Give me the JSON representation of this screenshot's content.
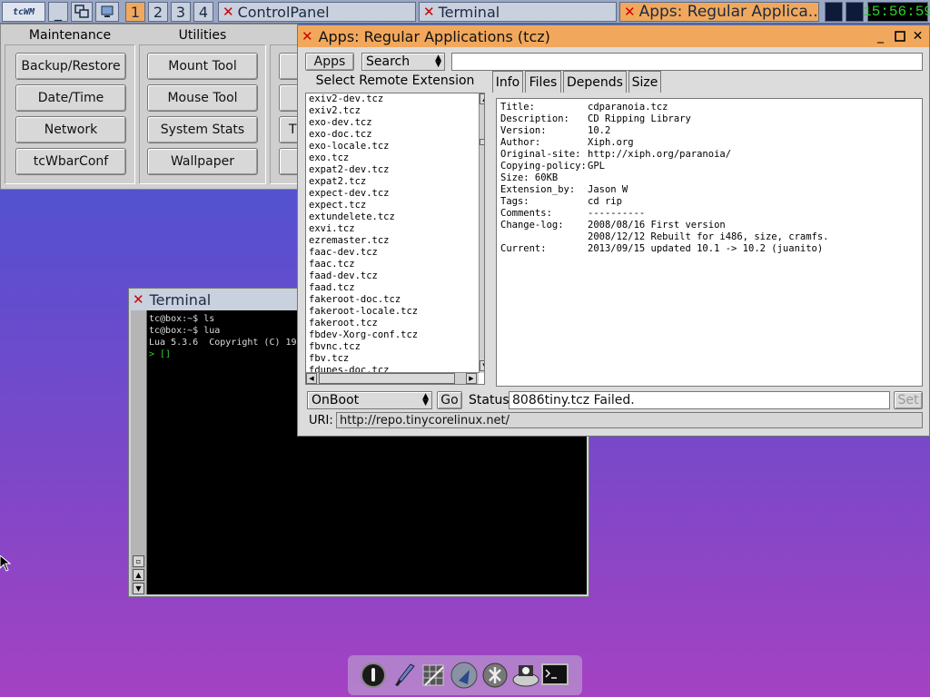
{
  "taskbar": {
    "logo": "tcWM",
    "workspaces": [
      "1",
      "2",
      "3",
      "4"
    ],
    "active_workspace": "1",
    "tasks": [
      {
        "label": "ControlPanel",
        "active": false
      },
      {
        "label": "Terminal",
        "active": false
      },
      {
        "label": "Apps: Regular Applica...",
        "active": true
      }
    ],
    "clock": "15:56:59"
  },
  "controlpanel": {
    "groups": [
      {
        "header": "Maintenance",
        "buttons": [
          "Backup/Restore",
          "Date/Time",
          "Network",
          "tcWbarConf"
        ]
      },
      {
        "header": "Utilities",
        "buttons": [
          "Mount Tool",
          "Mouse Tool",
          "System Stats",
          "Wallpaper"
        ]
      },
      {
        "header": "",
        "buttons": [
          "",
          "",
          "T",
          ""
        ]
      }
    ]
  },
  "terminal": {
    "title": "Terminal",
    "lines": [
      "tc@box:~$ ls",
      "tc@box:~$ lua",
      "Lua 5.3.6  Copyright (C) 19",
      "> []"
    ]
  },
  "apps": {
    "title": "Apps: Regular Applications (tcz)",
    "menu_apps": "Apps",
    "search_choice": "Search",
    "search_value": "",
    "list_title": "Select Remote Extension",
    "extensions": [
      "exiv2-dev.tcz",
      "exiv2.tcz",
      "exo-dev.tcz",
      "exo-doc.tcz",
      "exo-locale.tcz",
      "exo.tcz",
      "expat2-dev.tcz",
      "expat2.tcz",
      "expect-dev.tcz",
      "expect.tcz",
      "extundelete.tcz",
      "exvi.tcz",
      "ezremaster.tcz",
      "faac-dev.tcz",
      "faac.tcz",
      "faad-dev.tcz",
      "faad.tcz",
      "fakeroot-doc.tcz",
      "fakeroot-locale.tcz",
      "fakeroot.tcz",
      "fbdev-Xorg-conf.tcz",
      "fbvnc.tcz",
      "fbv.tcz",
      "fdupes-doc.tcz"
    ],
    "tabs": [
      "Info",
      "Files",
      "Depends",
      "Size"
    ],
    "active_tab": "Info",
    "info": [
      {
        "k": "Title:",
        "v": "cdparanoia.tcz"
      },
      {
        "k": "Description:",
        "v": "CD Ripping Library"
      },
      {
        "k": "Version:",
        "v": "10.2"
      },
      {
        "k": "Author:",
        "v": "Xiph.org"
      },
      {
        "k": "Original-site:",
        "v": "http://xiph.org/paranoia/"
      },
      {
        "k": "Copying-policy:",
        "v": "GPL"
      },
      {
        "k": "Size: 60KB",
        "v": ""
      },
      {
        "k": "Extension_by:",
        "v": "Jason W"
      },
      {
        "k": "Tags:",
        "v": "cd rip"
      },
      {
        "k": "Comments:",
        "v": "----------"
      },
      {
        "k": "Change-log:",
        "v": "2008/08/16 First version"
      },
      {
        "k": "",
        "v": "2008/12/12 Rebuilt for i486, size, cramfs."
      },
      {
        "k": "Current:",
        "v": "2013/09/15 updated 10.1 -> 10.2 (juanito)"
      }
    ],
    "install_mode": "OnBoot",
    "go_label": "Go",
    "status_label": "Status",
    "status_value": "8086tiny.tcz Failed.",
    "set_label": "Set",
    "uri_label": "URI:",
    "uri_value": "http://repo.tinycorelinux.net/"
  },
  "dock": {
    "icons": [
      "power-icon",
      "paint-brush-icon",
      "grid-app-icon",
      "globe-icon",
      "run-icon",
      "drive-icon",
      "terminal-icon"
    ]
  }
}
